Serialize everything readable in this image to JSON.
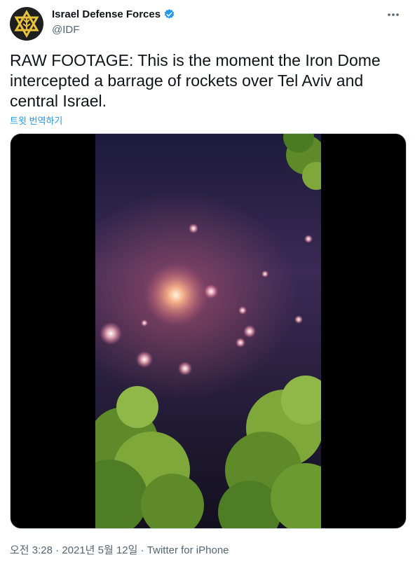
{
  "author": {
    "display_name": "Israel Defense Forces",
    "handle": "@IDF",
    "verified": true,
    "avatar_icon": "idf-emblem-icon"
  },
  "tweet": {
    "text": "RAW FOOTAGE: This is the moment the Iron Dome\nintercepted a barrage of rockets over Tel Aviv and\ncentral Israel.",
    "translate_label": "트윗 번역하기"
  },
  "media": {
    "type": "video",
    "description_icon": "video-frame-night-sky"
  },
  "meta": {
    "time": "오전 3:28",
    "separator": "·",
    "date": "2021년 5월 12일",
    "source": "Twitter for iPhone"
  },
  "colors": {
    "link": "#1d9bf0",
    "secondary_text": "#536471",
    "verified_badge": "#1d9bf0",
    "emblem_gold": "#e8c23a"
  }
}
